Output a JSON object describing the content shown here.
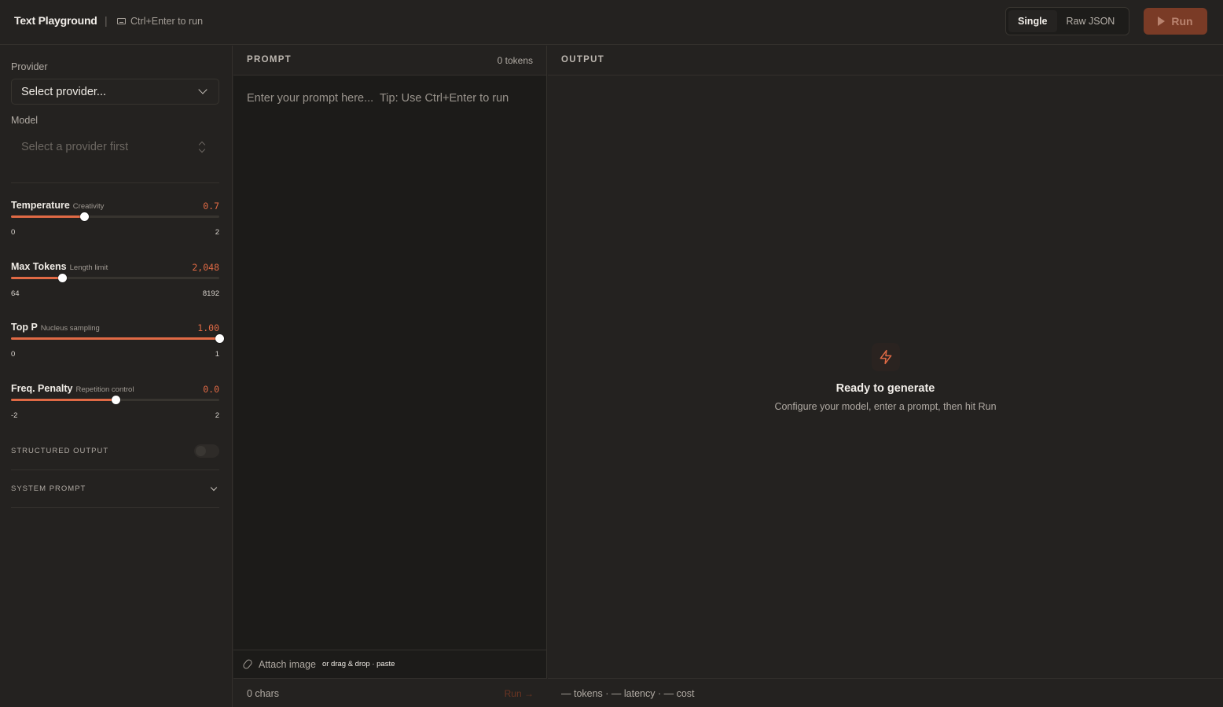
{
  "header": {
    "title": "Text Playground",
    "separator": "|",
    "shortcut_hint": "Ctrl+Enter to run",
    "modes": [
      "Single",
      "Raw JSON"
    ],
    "active_mode": "Single",
    "run_label": "Run"
  },
  "sidebar": {
    "provider": {
      "label": "Provider",
      "value": "Select provider..."
    },
    "model": {
      "label": "Model",
      "value": "Select a provider first"
    },
    "sliders": [
      {
        "name": "Temperature",
        "sub": "Creativity",
        "value": "0.7",
        "min": "0",
        "max": "2",
        "fraction": 0.35
      },
      {
        "name": "Max Tokens",
        "sub": "Length limit",
        "value": "2,048",
        "min": "64",
        "max": "8192",
        "fraction": 0.2441
      },
      {
        "name": "Top P",
        "sub": "Nucleus sampling",
        "value": "1.00",
        "min": "0",
        "max": "1",
        "fraction": 1.0
      },
      {
        "name": "Freq. Penalty",
        "sub": "Repetition control",
        "value": "0.0",
        "min": "-2",
        "max": "2",
        "fraction": 0.5
      }
    ],
    "structured_output": {
      "label": "STRUCTURED OUTPUT",
      "enabled": false
    },
    "system_prompt": {
      "label": "SYSTEM PROMPT"
    }
  },
  "prompt": {
    "title": "PROMPT",
    "tokens": "0 tokens",
    "placeholder": "Enter your prompt here...  Tip: Use Ctrl+Enter to run",
    "value": "",
    "attach_label": "Attach image",
    "attach_hint": "or drag & drop · paste",
    "char_count": "0 chars",
    "run_link": "Run →"
  },
  "output": {
    "title": "OUTPUT",
    "empty_title": "Ready to generate",
    "empty_subtitle": "Configure your model, enter a prompt, then hit Run",
    "metrics": "— tokens · — latency · — cost"
  },
  "colors": {
    "accent": "#e06a45",
    "run_button": "#7a3b26",
    "background": "#242220",
    "prompt_background": "#1c1b19"
  },
  "icons": {
    "shortcut": "keyboard-icon",
    "run": "play-icon",
    "provider_select": "chevron-down-icon",
    "model_select": "chevron-up-down-icon",
    "system_prompt": "chevron-down-icon",
    "attach": "paperclip-icon",
    "empty_state": "lightning-bolt-icon"
  }
}
